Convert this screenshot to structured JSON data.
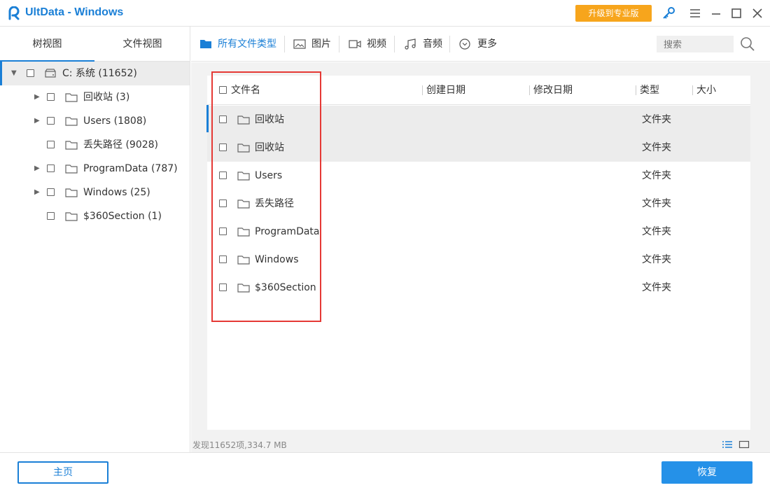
{
  "window": {
    "title": "UltData - Windows",
    "upgrade_label": "升级到专业版",
    "icons": [
      "key-icon",
      "menu-icon",
      "minimize-icon",
      "maximize-icon",
      "close-icon"
    ]
  },
  "left_tabs": [
    "树视图",
    "文件视图"
  ],
  "tree": {
    "root": "C: 系统 (11652)",
    "items": [
      {
        "label": "回收站 (3)",
        "expandable": true
      },
      {
        "label": "Users (1808)",
        "expandable": true
      },
      {
        "label": "丢失路径 (9028)",
        "expandable": false
      },
      {
        "label": "ProgramData (787)",
        "expandable": true
      },
      {
        "label": "Windows (25)",
        "expandable": true
      },
      {
        "label": "$360Section (1)",
        "expandable": false
      }
    ]
  },
  "type_nav": {
    "items": [
      "所有文件类型",
      "图片",
      "视频",
      "音频",
      "更多"
    ],
    "search_placeholder": "搜索"
  },
  "table": {
    "headers": [
      "文件名",
      "创建日期",
      "修改日期",
      "类型",
      "大小"
    ],
    "rows": [
      {
        "name": "回收站",
        "type": "文件夹"
      },
      {
        "name": "回收站",
        "type": "文件夹"
      },
      {
        "name": "Users",
        "type": "文件夹"
      },
      {
        "name": "丢失路径",
        "type": "文件夹"
      },
      {
        "name": "ProgramData",
        "type": "文件夹"
      },
      {
        "name": "Windows",
        "type": "文件夹"
      },
      {
        "name": "$360Section",
        "type": "文件夹"
      }
    ]
  },
  "status_text": "发现11652项,334.7 MB",
  "buttons": {
    "home": "主页",
    "recover": "恢复"
  },
  "colors": {
    "accent": "#1a7fd6",
    "upgrade": "#f7a51c",
    "highlight_box": "#e53935"
  }
}
